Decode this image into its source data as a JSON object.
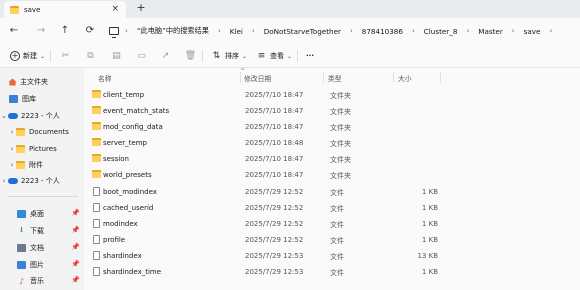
{
  "tab": {
    "title": "save",
    "close": "×",
    "new_tab": "+"
  },
  "nav": {
    "back": "←",
    "forward": "→",
    "up": "↑",
    "refresh": "⟳"
  },
  "breadcrumb": [
    "“此电脑”中的搜索结果",
    "Klei",
    "DoNotStarveTogether",
    "878410386",
    "Cluster_8",
    "Master",
    "save"
  ],
  "breadcrumb_sep": "›",
  "toolbar": {
    "new_label": "新建",
    "sort_label": "排序",
    "view_label": "查看",
    "more_label": "···"
  },
  "sidebar": {
    "home": "主文件夹",
    "gallery": "图库",
    "cloud1": "2223 - 个人",
    "documents": "Documents",
    "pictures": "Pictures",
    "attachments": "附件",
    "cloud2": "2223 - 个人",
    "desktop": "桌面",
    "downloads": "下载",
    "docs": "文档",
    "images": "图片",
    "music": "音乐"
  },
  "columns": {
    "name": "名称",
    "date": "修改日期",
    "type": "类型",
    "size": "大小"
  },
  "files": [
    {
      "name": "client_temp",
      "date": "2025/7/10 18:47",
      "type": "文件夹",
      "size": "",
      "kind": "folder"
    },
    {
      "name": "event_match_stats",
      "date": "2025/7/10 18:47",
      "type": "文件夹",
      "size": "",
      "kind": "folder"
    },
    {
      "name": "mod_config_data",
      "date": "2025/7/10 18:47",
      "type": "文件夹",
      "size": "",
      "kind": "folder"
    },
    {
      "name": "server_temp",
      "date": "2025/7/10 18:48",
      "type": "文件夹",
      "size": "",
      "kind": "folder"
    },
    {
      "name": "session",
      "date": "2025/7/10 18:47",
      "type": "文件夹",
      "size": "",
      "kind": "folder"
    },
    {
      "name": "world_presets",
      "date": "2025/7/10 18:47",
      "type": "文件夹",
      "size": "",
      "kind": "folder"
    },
    {
      "name": "boot_modindex",
      "date": "2025/7/29 12:52",
      "type": "文件",
      "size": "1 KB",
      "kind": "file"
    },
    {
      "name": "cached_userid",
      "date": "2025/7/29 12:52",
      "type": "文件",
      "size": "1 KB",
      "kind": "file"
    },
    {
      "name": "modindex",
      "date": "2025/7/29 12:52",
      "type": "文件",
      "size": "1 KB",
      "kind": "file"
    },
    {
      "name": "profile",
      "date": "2025/7/29 12:52",
      "type": "文件",
      "size": "1 KB",
      "kind": "file"
    },
    {
      "name": "shardindex",
      "date": "2025/7/29 12:53",
      "type": "文件",
      "size": "13 KB",
      "kind": "file"
    },
    {
      "name": "shardindex_time",
      "date": "2025/7/29 12:53",
      "type": "文件",
      "size": "1 KB",
      "kind": "file"
    }
  ],
  "colors": {
    "folder_back": "#e7a825",
    "folder_front": "#ffd15c",
    "cloud": "#1e6fd9"
  }
}
